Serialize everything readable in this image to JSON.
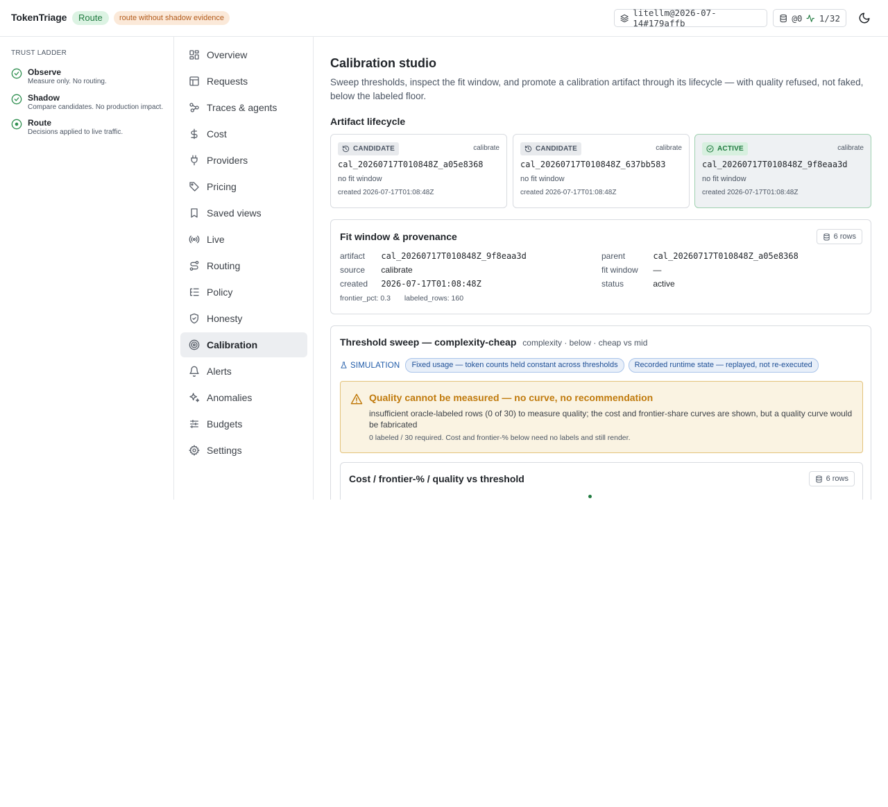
{
  "header": {
    "brand": "TokenTriage",
    "mode_badge": "Route",
    "warning_badge": "route without shadow evidence",
    "connection": "litellm@2026-07-14#179affb",
    "db_label": "@0",
    "activity": "1/32"
  },
  "ladder": {
    "title": "TRUST LADDER",
    "rungs": [
      {
        "name": "Observe",
        "desc": "Measure only. No routing."
      },
      {
        "name": "Shadow",
        "desc": "Compare candidates. No production impact."
      },
      {
        "name": "Route",
        "desc": "Decisions applied to live traffic."
      }
    ]
  },
  "nav": {
    "items": [
      {
        "label": "Overview",
        "icon": "dashboard-icon"
      },
      {
        "label": "Requests",
        "icon": "table-icon"
      },
      {
        "label": "Traces & agents",
        "icon": "workflow-icon"
      },
      {
        "label": "Cost",
        "icon": "dollar-icon"
      },
      {
        "label": "Providers",
        "icon": "plug-icon"
      },
      {
        "label": "Pricing",
        "icon": "tag-icon"
      },
      {
        "label": "Saved views",
        "icon": "bookmark-icon"
      },
      {
        "label": "Live",
        "icon": "radio-icon"
      },
      {
        "label": "Routing",
        "icon": "route-icon"
      },
      {
        "label": "Policy",
        "icon": "list-checks-icon"
      },
      {
        "label": "Honesty",
        "icon": "shield-check-icon"
      },
      {
        "label": "Calibration",
        "icon": "target-icon"
      },
      {
        "label": "Alerts",
        "icon": "bell-icon"
      },
      {
        "label": "Anomalies",
        "icon": "sparkles-icon"
      },
      {
        "label": "Budgets",
        "icon": "sliders-icon"
      },
      {
        "label": "Settings",
        "icon": "gear-icon"
      }
    ],
    "active": "Calibration"
  },
  "page": {
    "title": "Calibration studio",
    "lead": "Sweep thresholds, inspect the fit window, and promote a calibration artifact through its lifecycle — with quality refused, not faked, below the labeled floor.",
    "lifecycle_title": "Artifact lifecycle"
  },
  "artifacts": [
    {
      "state": "CANDIDATE",
      "source": "calibrate",
      "id": "cal_20260717T010848Z_a05e8368",
      "fit": "no fit window",
      "created": "created 2026-07-17T01:08:48Z"
    },
    {
      "state": "CANDIDATE",
      "source": "calibrate",
      "id": "cal_20260717T010848Z_637bb583",
      "fit": "no fit window",
      "created": "created 2026-07-17T01:08:48Z"
    },
    {
      "state": "ACTIVE",
      "source": "calibrate",
      "id": "cal_20260717T010848Z_9f8eaa3d",
      "fit": "no fit window",
      "created": "created 2026-07-17T01:08:48Z"
    }
  ],
  "fit_window": {
    "title": "Fit window & provenance",
    "rows_chip": "6 rows",
    "left": [
      {
        "k": "artifact",
        "v": "cal_20260717T010848Z_9f8eaa3d"
      },
      {
        "k": "source",
        "v": "calibrate"
      },
      {
        "k": "created",
        "v": "2026-07-17T01:08:48Z"
      }
    ],
    "right": [
      {
        "k": "parent",
        "v": "cal_20260717T010848Z_a05e8368"
      },
      {
        "k": "fit window",
        "v": "—"
      },
      {
        "k": "status",
        "v": "active"
      }
    ],
    "frontier_label": "frontier_pct:",
    "frontier_value": "0.3",
    "labeled_label": "labeled_rows:",
    "labeled_value": "160"
  },
  "sweep": {
    "title": "Threshold sweep — complexity-cheap",
    "subtitle": "complexity · below · cheap vs mid",
    "sim_label": "SIMULATION",
    "chips": [
      "Fixed usage — token counts held constant across thresholds",
      "Recorded runtime state — replayed, not re-executed"
    ],
    "warning_title": "Quality cannot be measured — no curve, no recommendation",
    "warning_body": "insufficient oracle-labeled rows (0 of 30) to measure quality; the cost and frontier-share curves are shown, but a quality curve would be fabricated",
    "warning_foot": "0 labeled / 30 required. Cost and frontier-% below need no labels and still render.",
    "chart_title": "Cost / frontier-% / quality vs threshold",
    "chart_rows_chip": "6 rows"
  },
  "colors": {
    "accent_green": "#1f7a3f",
    "warning_amber": "#c07a0c",
    "info_blue": "#1e5aa8"
  }
}
